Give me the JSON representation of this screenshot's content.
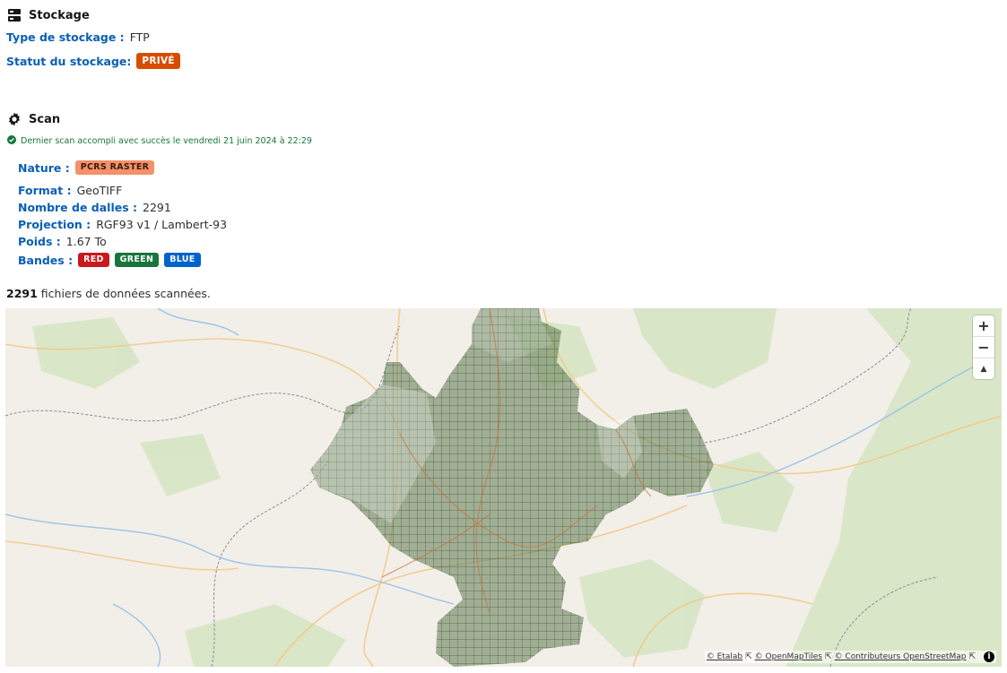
{
  "storage": {
    "title": "Stockage",
    "type_label": "Type de stockage :",
    "type_value": "FTP",
    "status_label": "Statut du stockage:",
    "status_value": "PRIVÉ"
  },
  "scan": {
    "title": "Scan",
    "status_text": "Dernier scan accompli avec succès le vendredi 21 juin 2024 à 22:29",
    "nature_label": "Nature :",
    "nature_value": "PCRS RASTER",
    "format_label": "Format :",
    "format_value": "GeoTIFF",
    "tiles_label": "Nombre de dalles :",
    "tiles_value": "2291",
    "projection_label": "Projection :",
    "projection_value": "RGF93 v1 / Lambert-93",
    "weight_label": "Poids :",
    "weight_value": "1.67 To",
    "bands_label": "Bandes :",
    "bands": [
      "RED",
      "GREEN",
      "BLUE"
    ]
  },
  "summary": {
    "count": "2291",
    "text": " fichiers de données scannées."
  },
  "map": {
    "zoom_in": "+",
    "zoom_out": "−",
    "north": "▲",
    "attribution": [
      "© Etalab",
      "© OpenMapTiles",
      "© Contributeurs OpenStreetMap"
    ],
    "info": "i",
    "colors": {
      "coverage_fill": "#5d7a4e",
      "coverage_stroke": "#2b3a22",
      "background": "#f2efe9",
      "forest": "#d6e6c4"
    }
  }
}
